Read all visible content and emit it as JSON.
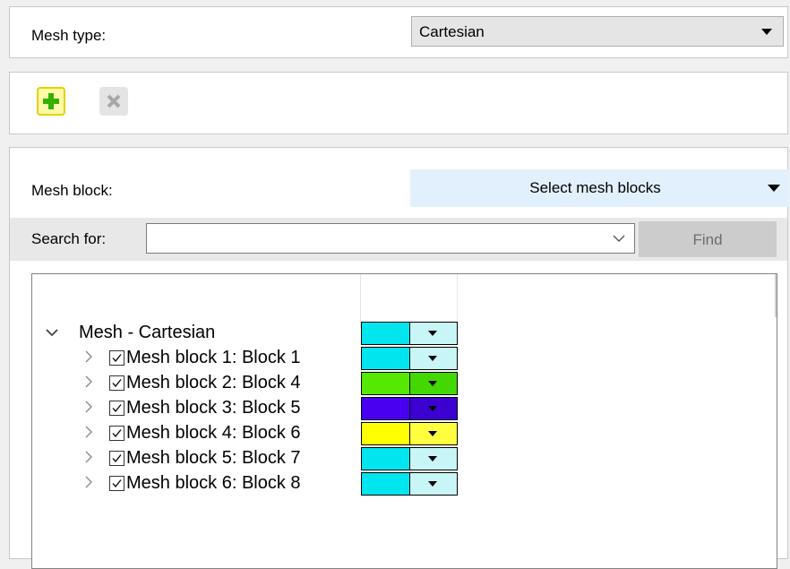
{
  "mesh_type": {
    "label": "Mesh type:",
    "value": "Cartesian"
  },
  "toolbar": {
    "add_icon": "plus-icon",
    "remove_icon": "close-icon",
    "add_color": "#33b000",
    "remove_color": "#a8a8a8"
  },
  "mesh_block": {
    "label": "Mesh block:",
    "value": "Select  mesh blocks"
  },
  "search": {
    "label": "Search for:",
    "value": "",
    "find_label": "Find"
  },
  "tree": {
    "root": {
      "label": "Mesh - Cartesian",
      "color": "#00e5ee",
      "dropdown_color": "#c8f6f6"
    },
    "items": [
      {
        "label": "Mesh block 1: Block 1",
        "checked": true,
        "color": "#00e5ee",
        "dropdown_color": "#c8f6f6"
      },
      {
        "label": "Mesh block 2: Block 4",
        "checked": true,
        "color": "#55e800",
        "dropdown_color": "#42d800"
      },
      {
        "label": "Mesh block 3: Block 5",
        "checked": true,
        "color": "#4a00f0",
        "dropdown_color": "#3c00d0"
      },
      {
        "label": "Mesh block 4: Block 6",
        "checked": true,
        "color": "#ffff00",
        "dropdown_color": "#ffff40"
      },
      {
        "label": "Mesh block 5: Block 7",
        "checked": true,
        "color": "#00e5ee",
        "dropdown_color": "#c8f6f6"
      },
      {
        "label": "Mesh block 6: Block 8",
        "checked": true,
        "color": "#00e5ee",
        "dropdown_color": "#c8f6f6"
      }
    ]
  }
}
